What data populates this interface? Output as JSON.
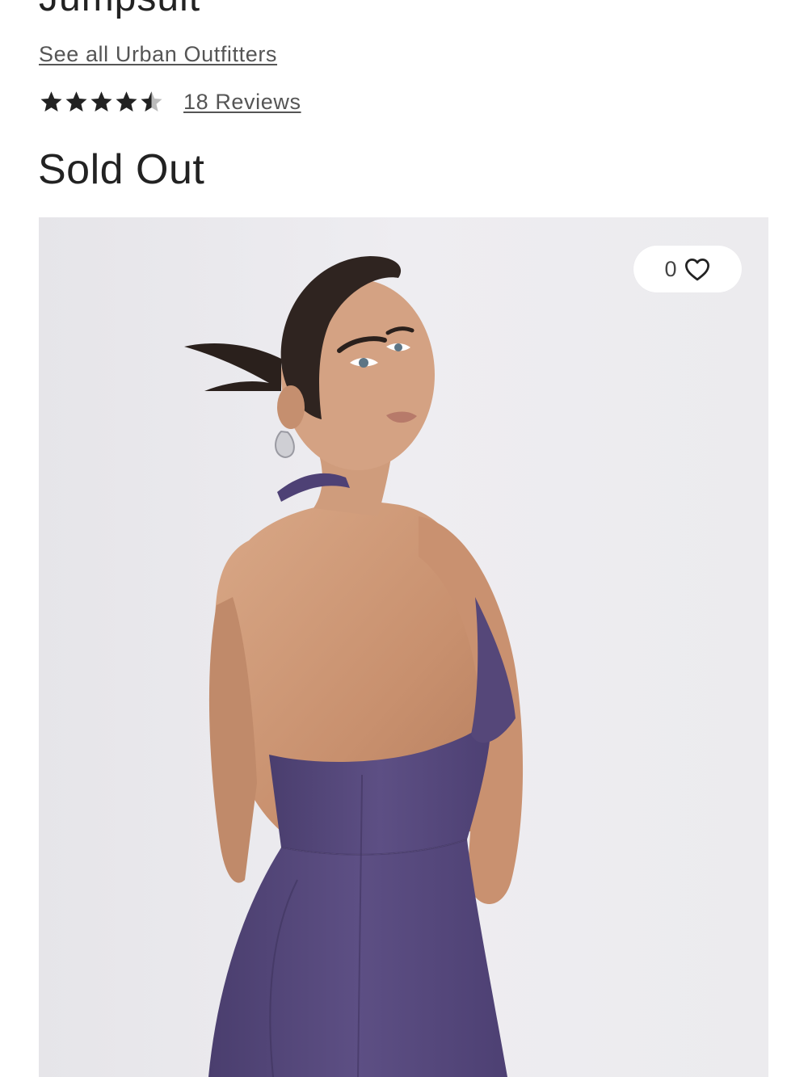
{
  "product": {
    "title": "Jumpsuit",
    "brand_link": "See all Urban Outfitters",
    "rating": 4.5,
    "rating_max": 5,
    "reviews_link": "18 Reviews",
    "availability": "Sold Out"
  },
  "gallery": {
    "wishlist_count": "0",
    "wishlist_icon": "heart-outline-icon",
    "image_subject": "model-in-purple-halter-jumpsuit"
  },
  "colors": {
    "text_primary": "#222222",
    "text_link": "#555555",
    "star_fill": "#222222",
    "star_empty": "#bbbbbb",
    "image_background": "#ecebee",
    "garment": "#5a4c80"
  }
}
